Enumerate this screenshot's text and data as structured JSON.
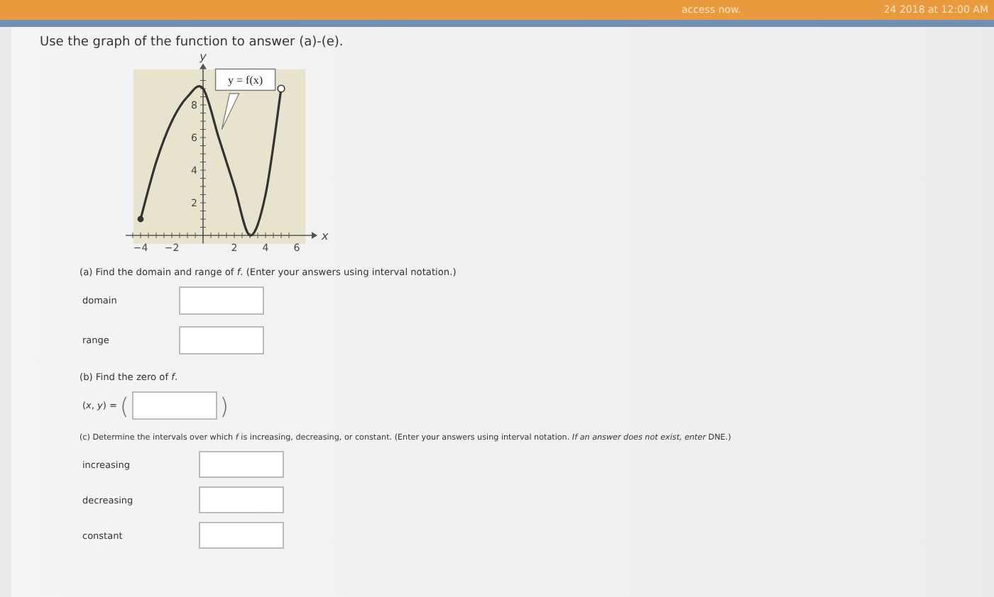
{
  "top_bar": {
    "left_text": "access now.",
    "right_text": "24 2018 at 12:00 AM"
  },
  "instruction": "Use the graph of the function to answer (a)-(e).",
  "graph": {
    "chart_data": {
      "type": "line",
      "xlabel": "x",
      "ylabel": "y",
      "x": [
        -4,
        -3,
        -2,
        -1,
        0,
        1,
        2,
        3,
        4,
        5
      ],
      "series": [
        {
          "name": "y = f(x)",
          "color": "#333333",
          "values": [
            1,
            4.5,
            7,
            8.5,
            9,
            6,
            3,
            0,
            2.5,
            9
          ]
        }
      ],
      "xticks": [
        {
          "value": -4,
          "label": "−4"
        },
        {
          "value": -2,
          "label": "−2"
        },
        2,
        4,
        6
      ],
      "yticks": [
        2,
        4,
        6,
        8
      ],
      "xlim": [
        -4.5,
        6.5
      ],
      "ylim": [
        -0.5,
        10.2
      ]
    }
  },
  "part_a": {
    "prompt": "(a) Find the domain and range of *f*. (Enter your answers using interval notation.)",
    "fields": [
      {
        "label": "domain"
      },
      {
        "label": "range"
      }
    ]
  },
  "part_b": {
    "prompt": "(b) Find the zero of *f*.",
    "label": "(*x*, *y*) =",
    "open_paren": "(",
    "close_paren": ")"
  },
  "part_c": {
    "prompt": "(c) Determine the intervals over which *f* is increasing, decreasing, or constant. (Enter your answers using interval notation. *If an answer does not exist, enter* DNE.)",
    "fields": [
      {
        "label": "increasing"
      },
      {
        "label": "decreasing"
      },
      {
        "label": "constant"
      }
    ]
  }
}
